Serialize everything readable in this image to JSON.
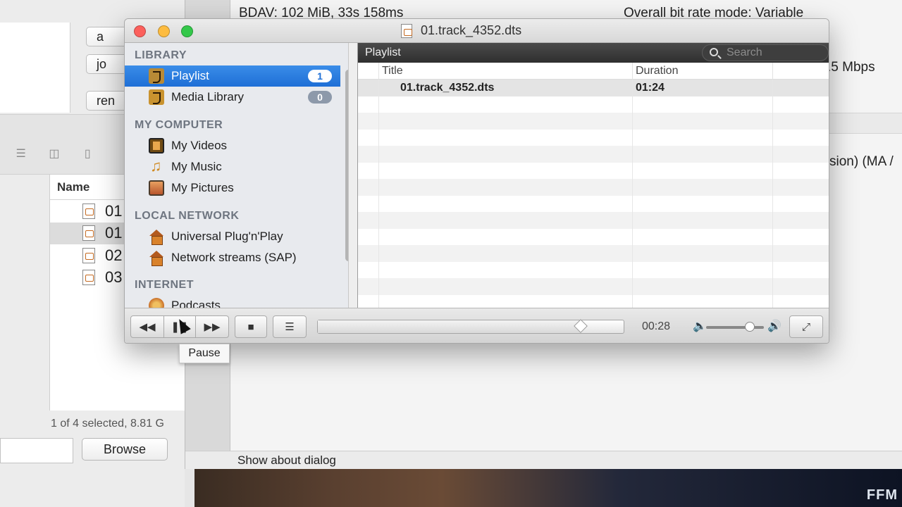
{
  "background": {
    "finder": {
      "side_buttons": [
        "a",
        "jo",
        "ren"
      ],
      "column_header": "Name",
      "files": [
        "01",
        "01",
        "02",
        "03"
      ],
      "status": "1 of 4 selected, 8.81 G",
      "browse_label": "Browse"
    },
    "info": {
      "line1_left": "BDAV: 102 MiB, 33s 158ms",
      "line1_right": "Overall bit rate mode: Variable",
      "line2_right": ".5 Mbps",
      "line3_right": "sion) (MA /",
      "footer": "Show about dialog"
    },
    "watermark": "FFM"
  },
  "vlc": {
    "window_title": "01.track_4352.dts",
    "sidebar": {
      "sections": {
        "library": "LIBRARY",
        "my_computer": "MY COMPUTER",
        "local_network": "LOCAL NETWORK",
        "internet": "INTERNET"
      },
      "items": {
        "playlist": {
          "label": "Playlist",
          "count": "1"
        },
        "media_library": {
          "label": "Media Library",
          "count": "0"
        },
        "my_videos": {
          "label": "My Videos"
        },
        "my_music": {
          "label": "My Music"
        },
        "my_pictures": {
          "label": "My Pictures"
        },
        "upnp": {
          "label": "Universal Plug'n'Play"
        },
        "sap": {
          "label": "Network streams (SAP)"
        },
        "podcasts": {
          "label": "Podcasts"
        }
      }
    },
    "playlist": {
      "header": "Playlist",
      "search_placeholder": "Search",
      "columns": {
        "title": "Title",
        "duration": "Duration"
      },
      "rows": [
        {
          "title": "01.track_4352.dts",
          "duration": "01:24"
        }
      ]
    },
    "controls": {
      "elapsed": "00:28",
      "progress_fraction": 0.86,
      "volume_fraction": 0.76,
      "tooltip": "Pause"
    }
  },
  "colors": {
    "selection_blue": "#1e6fd6",
    "close": "#fc605c",
    "minimize": "#fdbc40",
    "zoom": "#34c84a"
  }
}
